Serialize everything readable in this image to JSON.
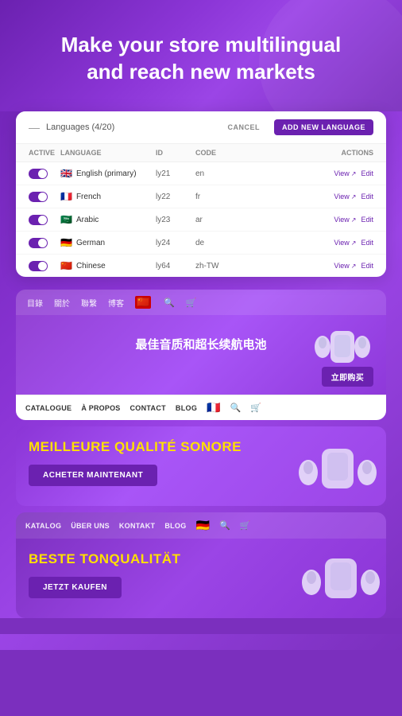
{
  "hero": {
    "title_line1": "Make your store multilingual",
    "title_line2": "and reach new markets"
  },
  "admin": {
    "header": {
      "dash": "—",
      "title": "Languages (4/20)",
      "cancel_label": "CANCEL",
      "add_label": "ADD NEW LANGUAGE"
    },
    "table": {
      "columns": [
        "Active",
        "Language",
        "ID",
        "Code",
        "Actions"
      ],
      "rows": [
        {
          "active": true,
          "flag": "🇬🇧",
          "language": "English (primary)",
          "id": "ly21",
          "code": "en",
          "view": "View",
          "edit": "Edit"
        },
        {
          "active": true,
          "flag": "🇫🇷",
          "language": "French",
          "id": "ly22",
          "code": "fr",
          "view": "View",
          "edit": "Edit"
        },
        {
          "active": true,
          "flag": "🇸🇦",
          "language": "Arabic",
          "id": "ly23",
          "code": "ar",
          "view": "View",
          "edit": "Edit"
        },
        {
          "active": true,
          "flag": "🇩🇪",
          "language": "German",
          "id": "ly24",
          "code": "de",
          "view": "View",
          "edit": "Edit"
        },
        {
          "active": true,
          "flag": "🇨🇳",
          "language": "Chinese",
          "id": "ly64",
          "code": "zh-TW",
          "view": "View",
          "edit": "Edit"
        }
      ]
    }
  },
  "chinese_store": {
    "nav_items": [
      "目錄",
      "關於",
      "聯繫",
      "博客"
    ],
    "flag": "🇨🇳",
    "hero_text": "最佳音质和超长续航电池",
    "buy_button": "立即购买"
  },
  "french_store": {
    "nav_items": [
      "CATALOGUE",
      "À PROPOS",
      "CONTACT",
      "BLOG"
    ],
    "flag": "🇫🇷",
    "hero_text": "MEILLEURE QUALITÉ SONORE",
    "buy_button": "ACHETER MAINTENANT"
  },
  "german_store": {
    "nav_items": [
      "KATALOG",
      "ÜBER UNS",
      "KONTAKT",
      "BLOG"
    ],
    "flag": "🇩🇪",
    "hero_text": "BESTE TONQUALITÄT",
    "buy_button": "JETZT KAUFEN"
  }
}
